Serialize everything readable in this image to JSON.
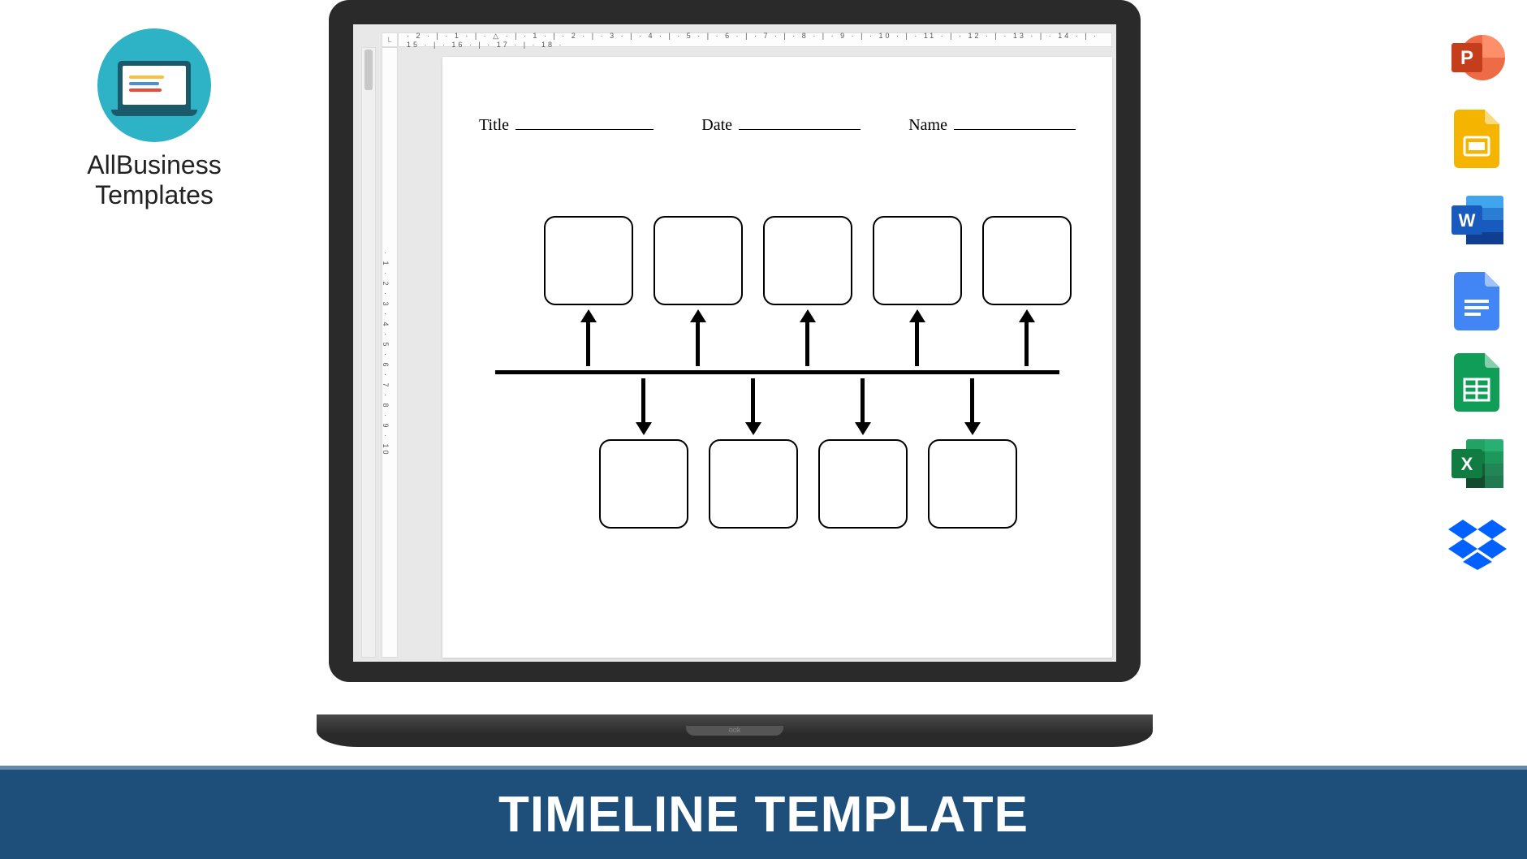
{
  "brand": {
    "line1": "AllBusiness",
    "line2": "Templates"
  },
  "document": {
    "ruler_h": "· 2 · | · 1 · | · △ · | · 1 · | · 2 · | · 3 · | · 4 · | · 5 · | · 6 · | · 7 · | · 8 · | · 9 · | · 10 · | · 11 · | · 12 · | · 13 · | · 14 · | · 15 · | · 16 · | · 17 · | · 18 ·",
    "ruler_v": "· 1 · 2 · 3 · 4 · 5 · 6 · 7 · 8 · 9 · 10",
    "ruler_corner": "L",
    "fields": {
      "title_label": "Title",
      "date_label": "Date",
      "name_label": "Name"
    },
    "timeline": {
      "top_boxes": 5,
      "bottom_boxes": 4
    },
    "hinge_text": "ook"
  },
  "banner": {
    "title": "TIMELINE TEMPLATE"
  },
  "app_icons": [
    {
      "name": "powerpoint",
      "letter": "P",
      "bg": "#d24726",
      "accent": "#b13b1f"
    },
    {
      "name": "google-slides",
      "letter": "",
      "bg": "#f4b400",
      "accent": "#fff"
    },
    {
      "name": "word",
      "letter": "W",
      "bg": "#2b579a",
      "accent": "#1e3f73"
    },
    {
      "name": "google-docs",
      "letter": "",
      "bg": "#4285f4",
      "accent": "#fff"
    },
    {
      "name": "google-sheets",
      "letter": "",
      "bg": "#0f9d58",
      "accent": "#fff"
    },
    {
      "name": "excel",
      "letter": "X",
      "bg": "#217346",
      "accent": "#185c37"
    },
    {
      "name": "dropbox",
      "letter": "",
      "bg": "#0061ff",
      "accent": ""
    }
  ]
}
